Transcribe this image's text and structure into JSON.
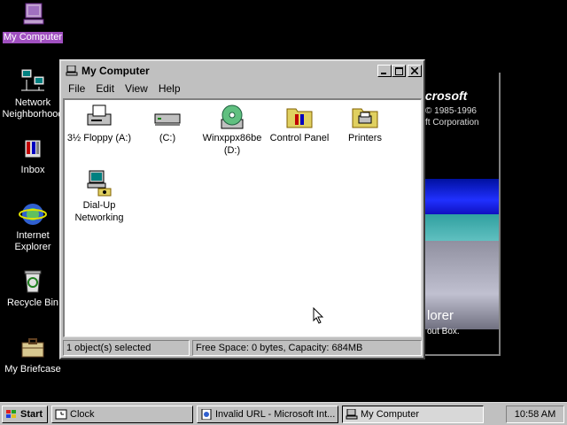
{
  "desktop": {
    "icons": [
      {
        "label": "My Computer"
      },
      {
        "label": "Network Neighborhood"
      },
      {
        "label": "Inbox"
      },
      {
        "label": "Internet Explorer"
      },
      {
        "label": "Recycle Bin"
      },
      {
        "label": "My Briefcase"
      }
    ]
  },
  "splash": {
    "logo": "icrosoft",
    "copyright": "© 1985-1996",
    "corp": "ft Corporation",
    "product": "lorer",
    "about": "out Box."
  },
  "window": {
    "title": "My Computer",
    "menu": [
      {
        "label": "File"
      },
      {
        "label": "Edit"
      },
      {
        "label": "View"
      },
      {
        "label": "Help"
      }
    ],
    "items": [
      {
        "label": "3½ Floppy (A:)"
      },
      {
        "label": "(C:)"
      },
      {
        "label": "Winxppx86be (D:)"
      },
      {
        "label": "Control Panel"
      },
      {
        "label": "Printers"
      },
      {
        "label": "Dial-Up Networking"
      }
    ],
    "status": {
      "selected": "1 object(s) selected",
      "space": "Free Space: 0 bytes, Capacity: 684MB"
    }
  },
  "taskbar": {
    "start": "Start",
    "buttons": [
      {
        "label": "Clock"
      },
      {
        "label": "Invalid URL - Microsoft Int..."
      },
      {
        "label": "My Computer"
      }
    ],
    "time": "10:58 AM"
  }
}
